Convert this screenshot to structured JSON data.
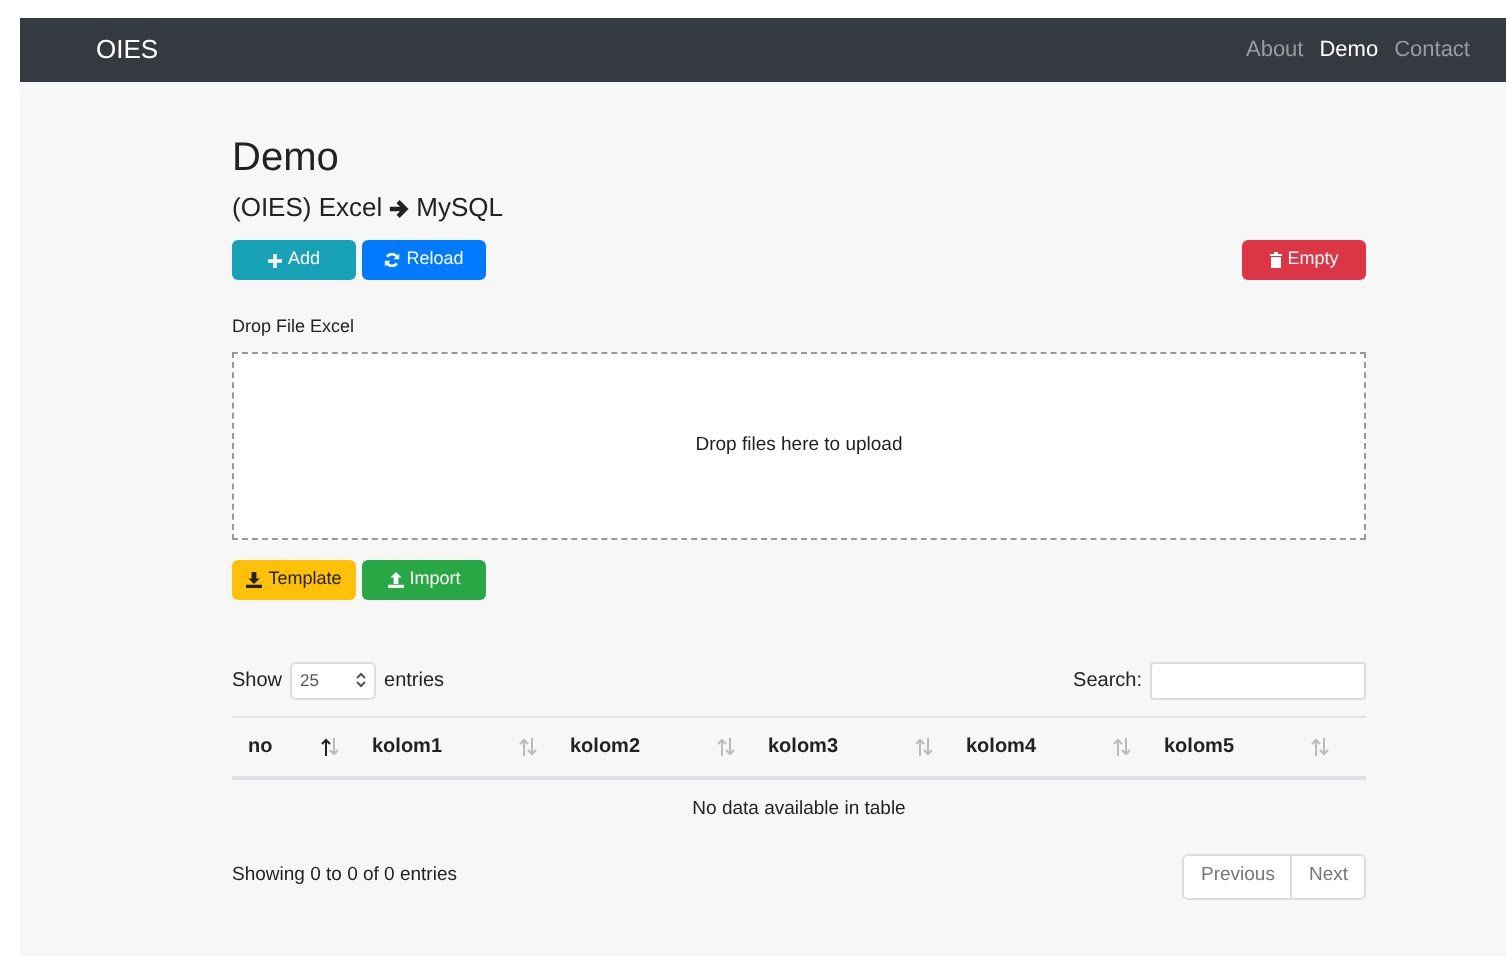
{
  "navbar": {
    "brand": "OIES",
    "links": [
      {
        "label": "About",
        "selected": false
      },
      {
        "label": "Demo",
        "selected": true
      },
      {
        "label": "Contact",
        "selected": false
      }
    ]
  },
  "heading": "Demo",
  "subtitle": {
    "before": "(OIES) Excel",
    "after": "MySQL"
  },
  "actions": [
    {
      "label": "Add",
      "kind": "add"
    },
    {
      "label": "Reload",
      "kind": "reload"
    }
  ],
  "danger_action": {
    "label": "Empty"
  },
  "dropzone": {
    "label": "Drop File Excel",
    "message": "Drop files here to upload"
  },
  "file_actions": [
    {
      "label": "Template",
      "kind": "template"
    },
    {
      "label": "Import",
      "kind": "import"
    }
  ],
  "table": {
    "length": {
      "before": "Show",
      "value": "25",
      "after": "entries"
    },
    "search_label": "Search:",
    "columns": [
      {
        "label": "no",
        "sorted": true
      },
      {
        "label": "kolom1",
        "sorted": false
      },
      {
        "label": "kolom2",
        "sorted": false
      },
      {
        "label": "kolom3",
        "sorted": false
      },
      {
        "label": "kolom4",
        "sorted": false
      },
      {
        "label": "kolom5",
        "sorted": false
      }
    ],
    "empty_message": "No data available in table",
    "info": "Showing 0 to 0 of 0 entries",
    "pager": [
      "Previous",
      "Next"
    ]
  }
}
